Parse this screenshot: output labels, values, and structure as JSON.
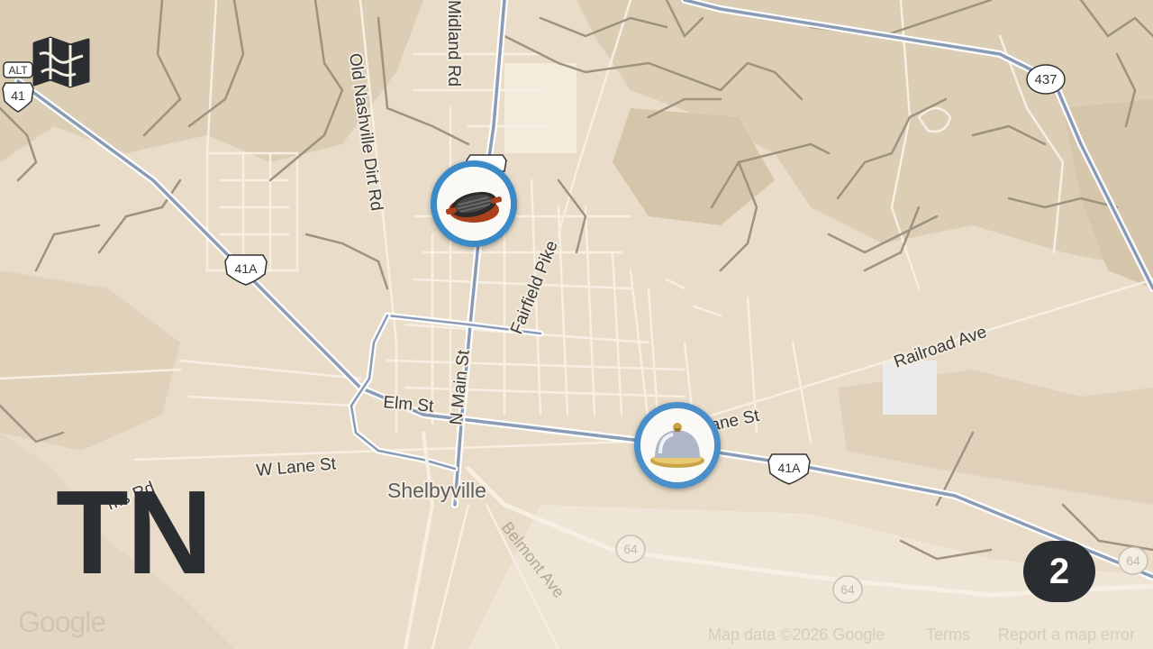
{
  "map": {
    "state_label": "TN",
    "count_badge": "2",
    "town_label": "Shelbyville",
    "road_labels": {
      "midland_rd": "Midland Rd",
      "old_nashville_dirt_rd": "Old Nashville Dirt Rd",
      "fairfield_pike": "Fairfield Pike",
      "n_main_st": "N Main St",
      "railroad_ave": "Railroad Ave",
      "elm_st": "Elm St",
      "w_lane_st": "W Lane St",
      "e_lane_st": "ane St",
      "ms_rd": "ms Rd",
      "belmont_ave": "Belmont Ave"
    },
    "shields": {
      "alt": "ALT",
      "us41": "41",
      "us41a_west": "41A",
      "us41a_east": "41A",
      "sr437": "437",
      "sr64_a": "64",
      "sr64_b": "64",
      "sr64_c": "64"
    },
    "google_logo": "Google",
    "attribution": {
      "map_data": "Map data ©2026 Google",
      "terms": "Terms",
      "report": "Report a map error"
    },
    "markers": [
      {
        "icon": "grill-pan-icon"
      },
      {
        "icon": "serving-cloche-icon"
      }
    ],
    "colors": {
      "marker_ring": "#3b8ac8",
      "highway": "#8a9bb5",
      "land": "#e9ddc9",
      "terrain": "#d8c9b1"
    }
  }
}
